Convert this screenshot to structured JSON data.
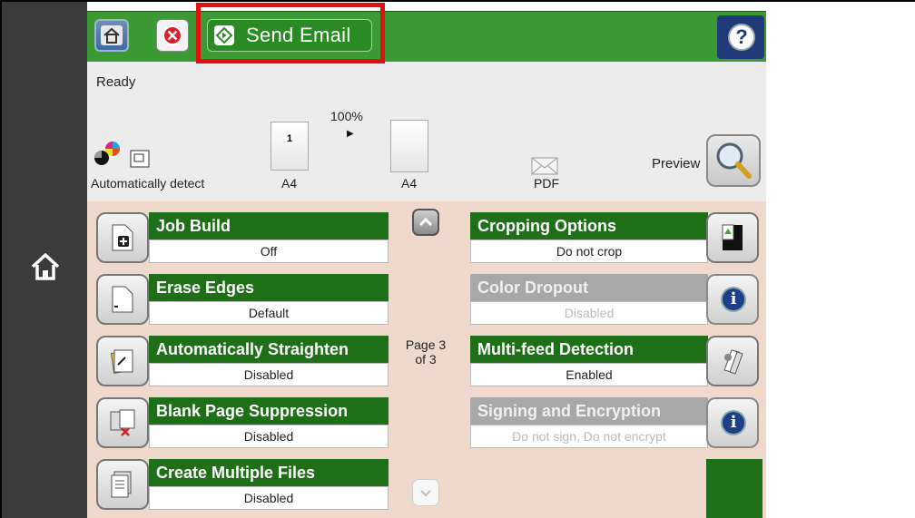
{
  "title_bar": {
    "send_label": "Send Email",
    "home_icon": "home-icon",
    "stop_icon": "stop-icon",
    "help_icon": "help-icon",
    "help_glyph": "?"
  },
  "status": {
    "ready_text": "Ready",
    "zoom": "100%",
    "color_mode": "Automatically detect",
    "source_size": "A4",
    "output_size": "A4",
    "file_type": "PDF",
    "preview_label": "Preview",
    "thumb_number": "1"
  },
  "rail": {
    "home_icon": "home-icon"
  },
  "options": {
    "left": [
      {
        "title": "Job Build",
        "value": "Off",
        "icon": "job-build-icon"
      },
      {
        "title": "Erase Edges",
        "value": "Default",
        "icon": "erase-edges-icon"
      },
      {
        "title": "Automatically Straighten",
        "value": "Disabled",
        "icon": "straighten-icon"
      },
      {
        "title": "Blank Page Suppression",
        "value": "Disabled",
        "icon": "blank-page-icon"
      },
      {
        "title": "Create Multiple Files",
        "value": "Disabled",
        "icon": "multiple-files-icon"
      }
    ],
    "right": [
      {
        "title": "Cropping Options",
        "value": "Do not crop",
        "icon": "cropping-icon",
        "enabled": true
      },
      {
        "title": "Color Dropout",
        "value": "Disabled",
        "icon": "info-icon",
        "enabled": false
      },
      {
        "title": "Multi-feed Detection",
        "value": "Enabled",
        "icon": "multi-feed-icon",
        "enabled": true
      },
      {
        "title": "Signing and Encryption",
        "value": "Do not sign, Do not encrypt",
        "icon": "info-icon",
        "enabled": false
      }
    ],
    "page_indicator_line1": "Page 3",
    "page_indicator_line2": "of 3",
    "info_glyph": "i"
  },
  "colors": {
    "title_green": "#3c9a34",
    "option_green": "#1e6f18",
    "highlight_red": "#e01010",
    "options_bg": "#efd9cc"
  }
}
